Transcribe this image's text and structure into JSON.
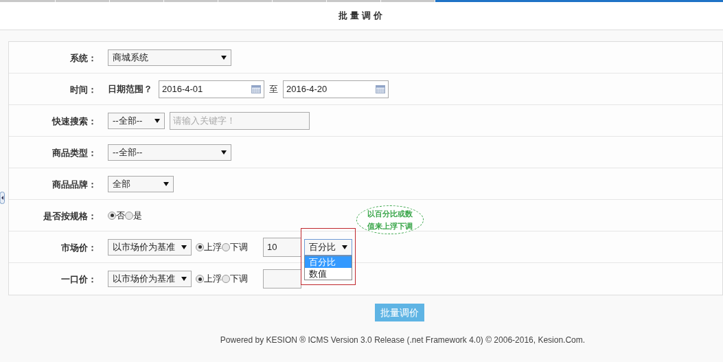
{
  "title": "批量调价",
  "rows": [
    {
      "kind": "select",
      "label": "系统：",
      "value": "商城系统"
    },
    {
      "kind": "daterange",
      "label": "时间：",
      "prompt": "日期范围？",
      "from": "2016-4-01",
      "sep": "至",
      "to": "2016-4-20"
    },
    {
      "kind": "search",
      "label": "快速搜索：",
      "value": "--全部--",
      "placeholder": "请输入关键字！"
    },
    {
      "kind": "select",
      "label": "商品类型：",
      "value": "--全部--"
    },
    {
      "kind": "short-select",
      "label": "商品品牌：",
      "value": "全部"
    },
    {
      "kind": "radios",
      "label": "是否按规格：",
      "options": [
        {
          "label": "否",
          "selected": true
        },
        {
          "label": "是",
          "selected": false
        }
      ]
    },
    {
      "kind": "price",
      "label": "市场价：",
      "base": "以市场价为基准",
      "options": [
        {
          "label": "上浮",
          "selected": true
        },
        {
          "label": "下调",
          "selected": false
        }
      ],
      "amount": "10",
      "unit": "百分比",
      "menu": [
        {
          "label": "百分比",
          "selected": true
        },
        {
          "label": "数值",
          "selected": false
        }
      ]
    },
    {
      "kind": "price",
      "label": "一口价：",
      "base": "以市场价为基准",
      "options": [
        {
          "label": "上浮",
          "selected": true
        },
        {
          "label": "下调",
          "selected": false
        }
      ]
    }
  ],
  "callout": [
    "以百分比或数",
    "值来上浮下调"
  ],
  "submit": "批量调价",
  "footer": "Powered by KESION ® ICMS Version 3.0 Release (.net Framework 4.0) © 2006-2016, Kesion.Com."
}
